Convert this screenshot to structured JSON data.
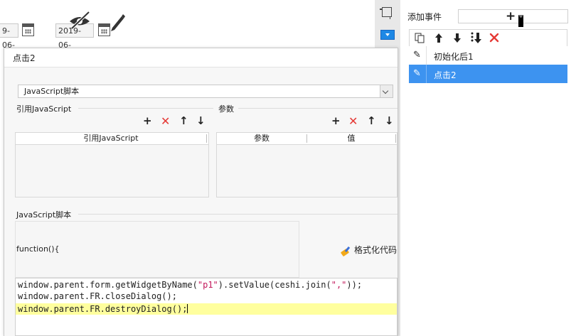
{
  "background": {
    "date_start_text": "9-06-",
    "date_end_text": "2019-06-"
  },
  "event_panel": {
    "title": "添加事件",
    "add_label": "+",
    "toolbar_icons": [
      "copy-icon",
      "arrow-up-icon",
      "arrow-down-icon",
      "move-bottom-icon",
      "delete-icon"
    ],
    "events": [
      {
        "label": "初始化后1",
        "selected": false
      },
      {
        "label": "点击2",
        "selected": true
      }
    ]
  },
  "dialog": {
    "title": "点击2",
    "script_type": "JavaScript脚本",
    "ref_js": {
      "label": "引用JavaScript",
      "columns": [
        "引用JavaScript"
      ]
    },
    "params": {
      "label": "参数",
      "columns": [
        "参数",
        "值"
      ]
    },
    "script": {
      "label": "JavaScript脚本",
      "function_header": "function(){",
      "format_label": "格式化代码",
      "code_lines": [
        "window.parent.form.getWidgetByName(\"p1\").setValue(ceshi.join(\",\"));",
        "window.parent.FR.closeDialog();",
        "window.parent.FR.destroyDialog();"
      ]
    }
  },
  "colors": {
    "selection_blue": "#3d93f0",
    "delete_red": "#e53935",
    "active_line": "#ffff9e"
  }
}
